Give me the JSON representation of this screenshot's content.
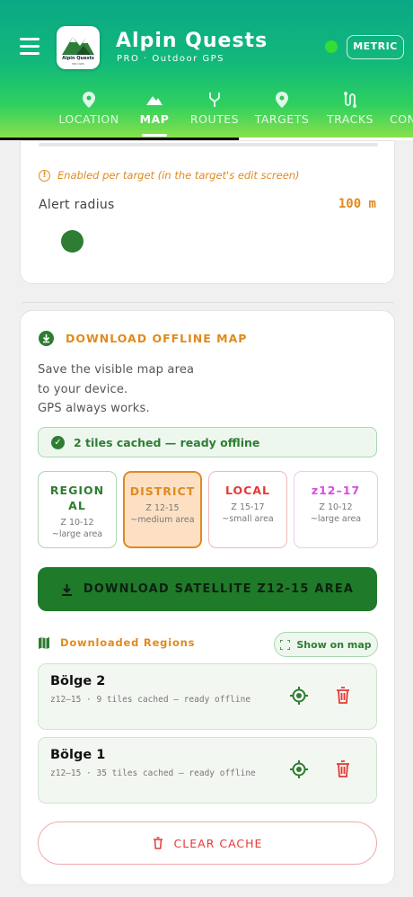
{
  "app": {
    "title": "Alpin Quests",
    "subtitle": "PRO · Outdoor GPS",
    "logo_text": "Alpin Quests",
    "logo_sub": "PRO GPS",
    "units_button": "METRIC",
    "status_color": "#33dd33"
  },
  "tabs": [
    {
      "label": "LOCATION",
      "icon": "pin-icon"
    },
    {
      "label": "MAP",
      "icon": "mountain-icon",
      "active": true
    },
    {
      "label": "ROUTES",
      "icon": "fork-icon"
    },
    {
      "label": "TARGETS",
      "icon": "pin-icon"
    },
    {
      "label": "TRACKS",
      "icon": "track-icon"
    },
    {
      "label": "CON",
      "icon": "none"
    }
  ],
  "alerts": {
    "note": "Enabled per target (in the target's edit screen)",
    "radius_label": "Alert radius",
    "radius_value": "100 m"
  },
  "offline": {
    "title": "DOWNLOAD OFFLINE MAP",
    "description": [
      "Save the visible map area",
      "to your device.",
      "GPS always works."
    ],
    "cached_status": "2 tiles cached — ready offline",
    "zoom_levels": [
      {
        "title": "REGIONAL",
        "range": "Z 10-12",
        "desc": "~large area",
        "selected": false
      },
      {
        "title": "DISTRICT",
        "range": "Z 12-15",
        "desc": "~medium area",
        "selected": true
      },
      {
        "title": "LOCAL",
        "range": "Z 15-17",
        "desc": "~small area",
        "selected": false
      },
      {
        "title": "z12–17",
        "range": "Z 10-12",
        "desc": "~large area",
        "selected": false
      }
    ],
    "download_button": "DOWNLOAD SATELLITE Z12-15 AREA",
    "regions_title": "Downloaded Regions",
    "show_on_map": "Show on map",
    "regions": [
      {
        "name": "Bölge 2",
        "desc": "z12–15 · 9 tiles cached — ready offline"
      },
      {
        "name": "Bölge 1",
        "desc": "z12–15 · 35 tiles cached — ready offline"
      }
    ],
    "clear_button": "CLEAR CACHE"
  },
  "colors": {
    "accent_orange": "#e08a1e",
    "primary_green": "#2e7d32",
    "danger_red": "#e53935"
  }
}
